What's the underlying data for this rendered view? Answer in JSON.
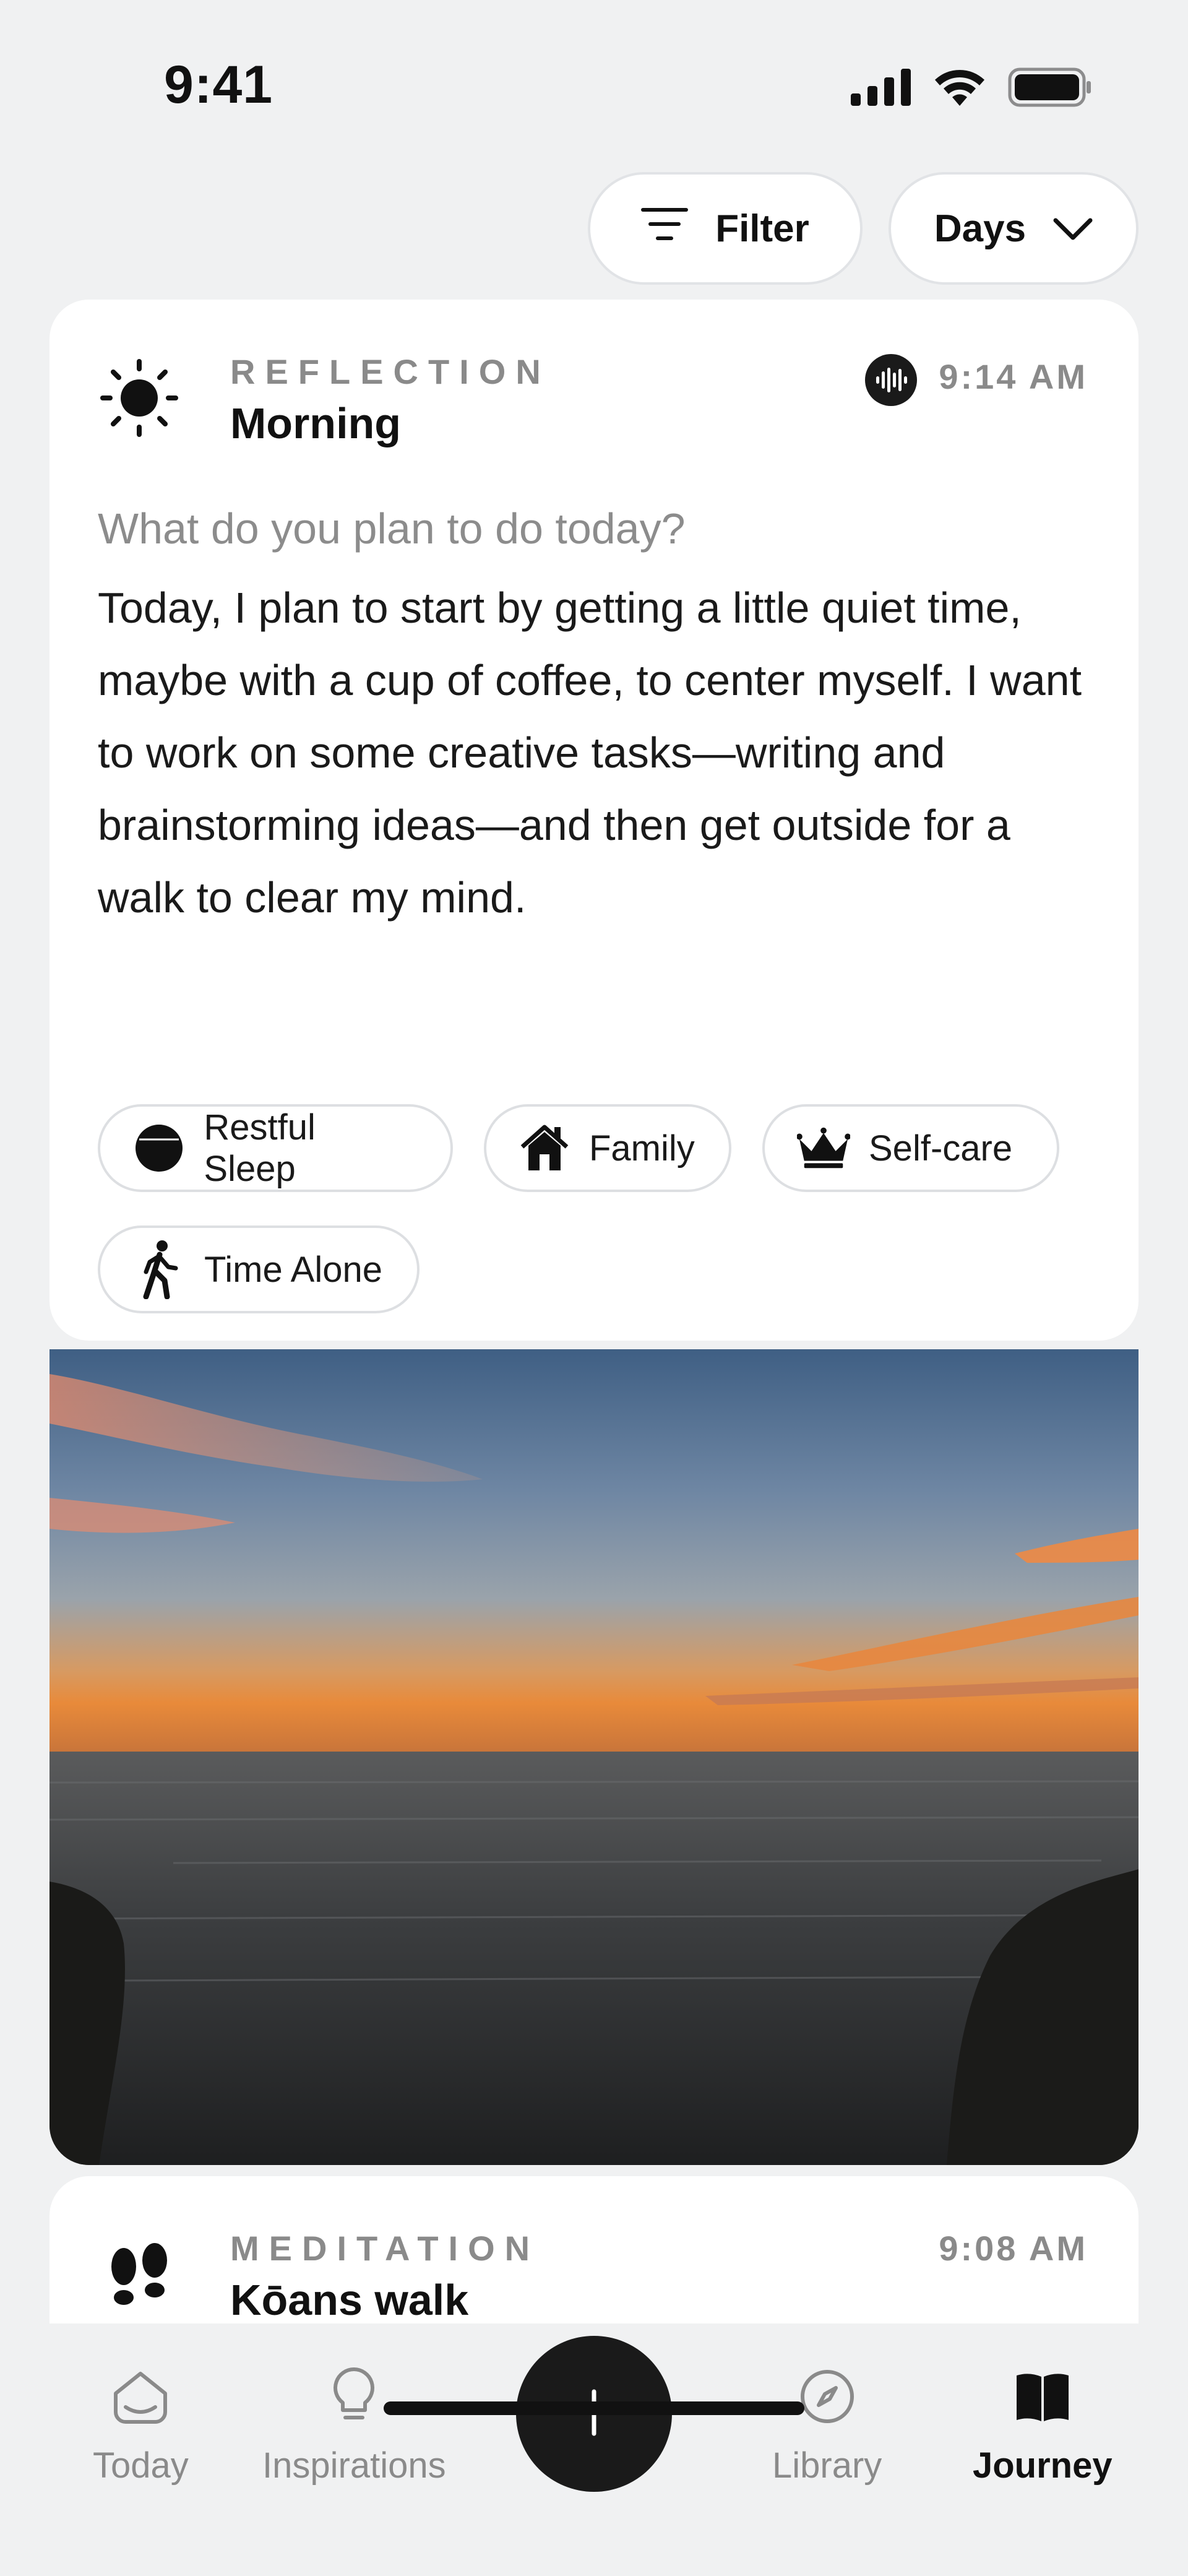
{
  "status_bar": {
    "time": "9:41"
  },
  "controls": {
    "filter_label": "Filter",
    "days_label": "Days"
  },
  "entries": [
    {
      "type": "REFLECTION",
      "title": "Morning",
      "time": "9:14 AM",
      "icon": "sun-icon",
      "has_audio": true,
      "prompt": "What do you plan to do today?",
      "text": "Today, I plan to start by getting a little quiet time, maybe with a cup of coffee, to center myself. I want to work on some creative tasks—writing and brainstorming ideas—and then get outside for a walk to clear my mind.",
      "tags": [
        {
          "label": "Restful Sleep",
          "icon": "half-moon-icon"
        },
        {
          "label": "Family",
          "icon": "house-icon"
        },
        {
          "label": "Self-care",
          "icon": "crown-icon"
        },
        {
          "label": "Time Alone",
          "icon": "walking-person-icon"
        }
      ],
      "photo": "ocean sunset photo"
    },
    {
      "type": "MEDITATION",
      "title": "Kōans walk",
      "time": "9:08 AM",
      "icon": "footprints-icon"
    }
  ],
  "tab_bar": {
    "tabs": [
      {
        "label": "Today",
        "icon": "home-icon",
        "active": false
      },
      {
        "label": "Inspirations",
        "icon": "lightbulb-icon",
        "active": false
      },
      {
        "label": "Library",
        "icon": "compass-icon",
        "active": false
      },
      {
        "label": "Journey",
        "icon": "book-icon",
        "active": true
      }
    ],
    "add_icon": "plus-icon"
  },
  "colors": {
    "background": "#F0F1F2",
    "card": "#FFFFFF",
    "primary_text": "#1A1A1A",
    "secondary_text": "#8A8A8A",
    "accent_dark": "#1A1A1A"
  }
}
